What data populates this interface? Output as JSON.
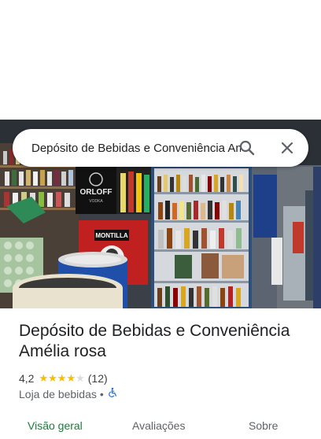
{
  "search": {
    "query": "Depósito de Bebidas e Conveniência Amélia rosa",
    "search_icon": "search-icon",
    "close_icon": "close-icon"
  },
  "place": {
    "name": "Depósito de Bebidas e Conveniência Amélia rosa",
    "rating": "4,2",
    "rating_value": 4.2,
    "stars_filled": 4,
    "stars_total": 5,
    "review_count": "(12)",
    "category": "Loja de bebidas",
    "separator": "•",
    "accessibility_icon": "wheelchair-icon"
  },
  "tabs": [
    {
      "label": "Visão geral",
      "active": true
    },
    {
      "label": "Avaliações",
      "active": false
    },
    {
      "label": "Sobre",
      "active": false
    }
  ],
  "photo_signs": {
    "orloff_line1": "ORLOFF",
    "orloff_line2": "VODKA",
    "montilla": "MONTILLA"
  },
  "colors": {
    "star": "#fbbc04",
    "active_tab": "#188038",
    "accessibility": "#1a73e8"
  }
}
